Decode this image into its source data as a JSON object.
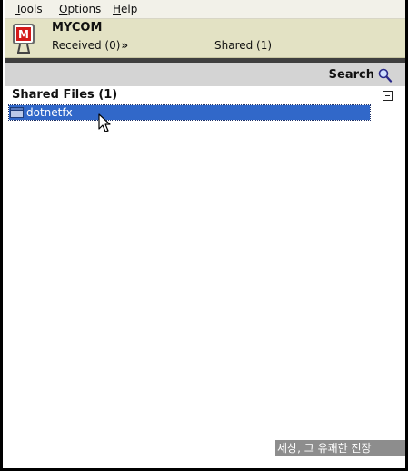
{
  "menu": {
    "tools": {
      "accel": "T",
      "rest": "ools"
    },
    "options": {
      "accel": "O",
      "rest": "ptions"
    },
    "help": {
      "accel": "H",
      "rest": "elp"
    }
  },
  "header": {
    "title": "MYCOM",
    "received_label": "Received (0)",
    "shared_label": "Shared (1)"
  },
  "search": {
    "label": "Search"
  },
  "content": {
    "section_title": "Shared Files (1)",
    "items": [
      {
        "name": "dotnetfx",
        "selected": true
      }
    ]
  },
  "caption": "세상, 그 유쾌한 전장",
  "colors": {
    "header_bg": "#e3e2c4",
    "menubar_bg": "#f2f1e9",
    "selection": "#3168c9",
    "searchbar_bg": "#d4d4d4",
    "separator": "#3f3f3f",
    "caption_bg": "#8d8d8d"
  },
  "icons": [
    "app-logo-icon",
    "double-chevron-down-icon",
    "search-icon",
    "collapse-icon",
    "folder-icon",
    "mouse-cursor-icon"
  ]
}
